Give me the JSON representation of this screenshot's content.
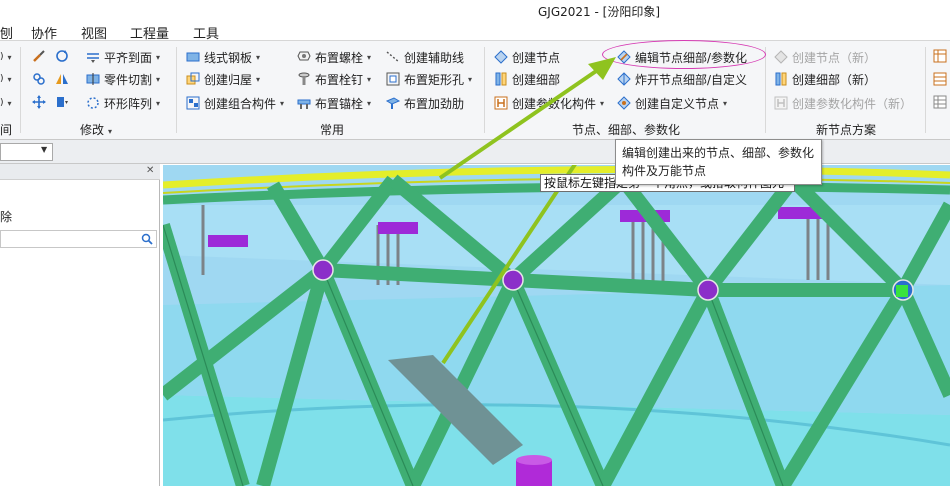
{
  "window": {
    "title": "GJG2021 - [汾阳印象]"
  },
  "menu": {
    "items": [
      "协作",
      "视图",
      "工程量",
      "工具"
    ],
    "cut_left": "刨"
  },
  "ribbon": {
    "modify": {
      "flat_to_face": "平齐到面",
      "part_cut": "零件切割",
      "ring_array": "环形阵列",
      "group_label": "修改"
    },
    "common": {
      "line_steel_plate": "线式钢板",
      "create_group": "创建归屋",
      "create_component_group": "创建组合构件",
      "place_bolt": "布置螺栓",
      "place_stud": "布置栓钉",
      "place_anchor": "布置锚栓",
      "create_aux_line": "创建辅助线",
      "place_rect_hole": "布置矩形孔",
      "place_stiffener": "布置加劲肋",
      "group_label": "常用"
    },
    "node": {
      "create_node": "创建节点",
      "create_detail": "创建细部",
      "create_param": "创建参数化构件",
      "edit_node": "编辑节点细部/参数化",
      "explode_node": "炸开节点细部/自定义",
      "create_custom_node": "创建自定义节点",
      "group_label": "节点、细部、参数化"
    },
    "new_node": {
      "create_node_new": "创建节点（新）",
      "create_detail_new": "创建细部（新）",
      "create_param_new": "创建参数化构件（新）",
      "group_label": "新节点方案"
    },
    "left_group_label": "间"
  },
  "left_panel": {
    "delete_label": "除"
  },
  "tooltip": {
    "line1": "编辑创建出来的节点、细部、参数化",
    "line2": "构件及万能节点"
  },
  "status_hint": {
    "text": "按鼠标左键指定第一个角点，或拾取构件图元"
  },
  "colors": {
    "accent_highlight": "#d63cb4",
    "arrow": "#8fc31f",
    "beam": "#3fae73",
    "sky": "#9fd8f2",
    "floor": "#7fe0ea",
    "node_ball": "#8b2fc9",
    "gusset": "#9d2ad8"
  }
}
